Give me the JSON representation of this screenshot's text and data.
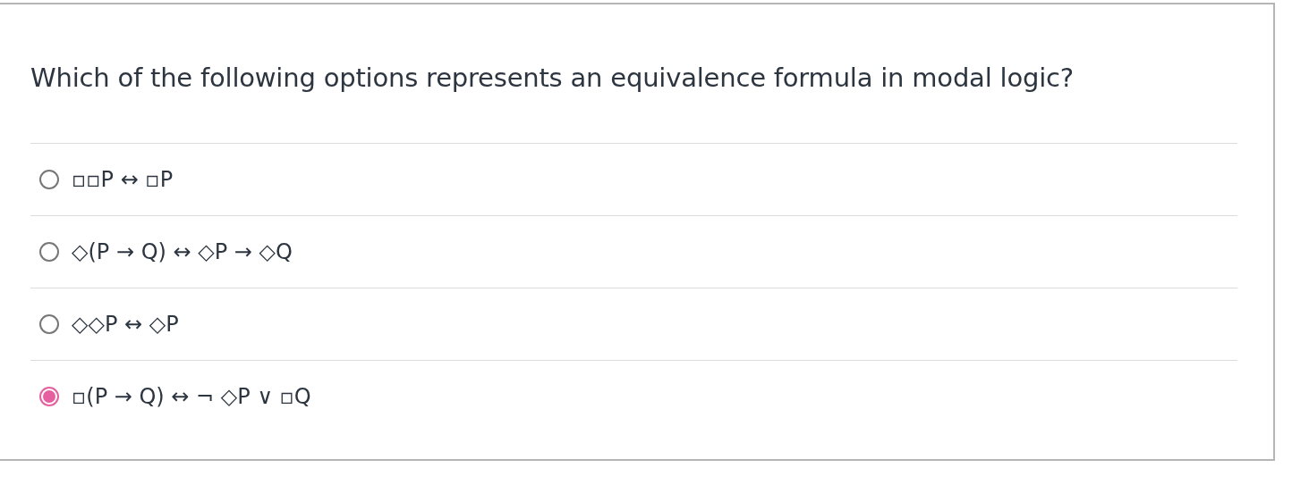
{
  "question": "Which of the following options represents an equivalence formula in modal logic?",
  "options": [
    {
      "label": "▫▫P ↔ ▫P",
      "selected": false
    },
    {
      "label": "◇(P → Q) ↔ ◇P → ◇Q",
      "selected": false
    },
    {
      "label": "◇◇P ↔ ◇P",
      "selected": false
    },
    {
      "label": "▫(P → Q) ↔ ¬ ◇P ∨ ▫Q",
      "selected": true
    }
  ]
}
